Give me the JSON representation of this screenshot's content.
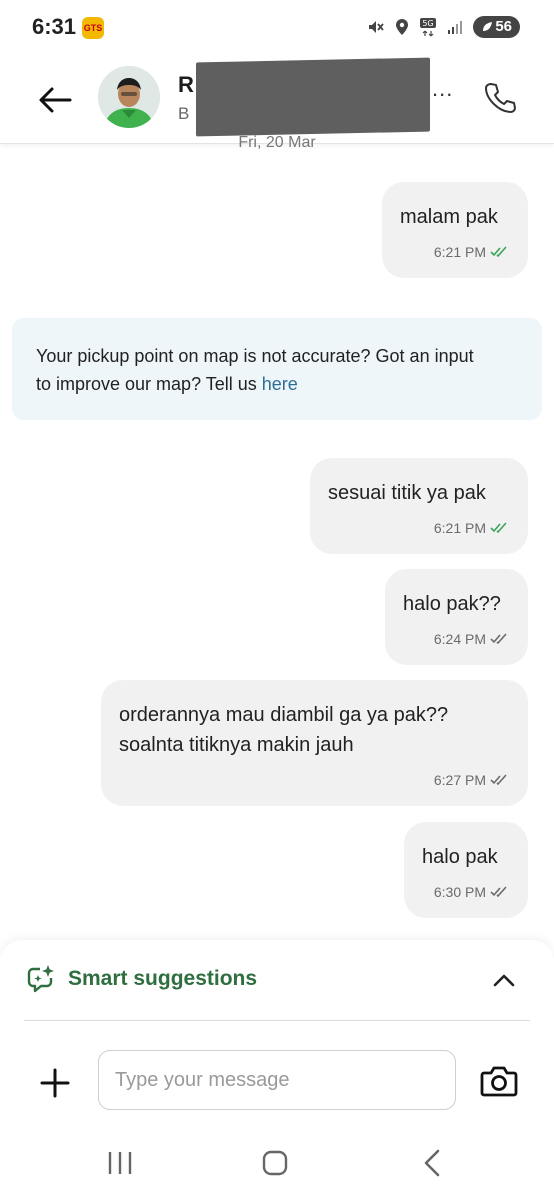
{
  "status_bar": {
    "time": "6:31",
    "app_badge": "GTS",
    "battery": "56"
  },
  "header": {
    "contact_name_initial": "R",
    "contact_sub_initial": "B",
    "more_indicator": "..."
  },
  "conversation": {
    "date_label": "Fri, 20 Mar",
    "messages": [
      {
        "text": "malam pak",
        "time": "6:21 PM",
        "status": "read"
      },
      {
        "text": "sesuai titik ya pak",
        "time": "6:21 PM",
        "status": "read"
      },
      {
        "text": "halo pak??",
        "time": "6:24 PM",
        "status": "delivered"
      },
      {
        "text_line1": "orderannya mau diambil ga ya pak??",
        "text_line2": "soalnta titiknya makin jauh",
        "time": "6:27 PM",
        "status": "delivered"
      },
      {
        "text": "halo pak",
        "time": "6:30 PM",
        "status": "delivered"
      }
    ],
    "info_banner": {
      "text_line1": "Your pickup point on map is not accurate? Got an input",
      "text_line2": "to improve our map? Tell us ",
      "link": "here"
    }
  },
  "bottom_panel": {
    "smart_suggestions_label": "Smart suggestions",
    "composer_placeholder": "Type your message"
  },
  "colors": {
    "read_tick": "#3aa35b",
    "delivered_tick": "#6b6b6b",
    "suggestion_green": "#2e6e3f",
    "link_blue": "#2b6f95"
  },
  "icons": [
    "back-arrow-icon",
    "phone-icon",
    "sparkle-chat-icon",
    "chevron-up-icon",
    "plus-icon",
    "camera-icon",
    "nav-recents-icon",
    "nav-home-icon",
    "nav-back-icon"
  ]
}
